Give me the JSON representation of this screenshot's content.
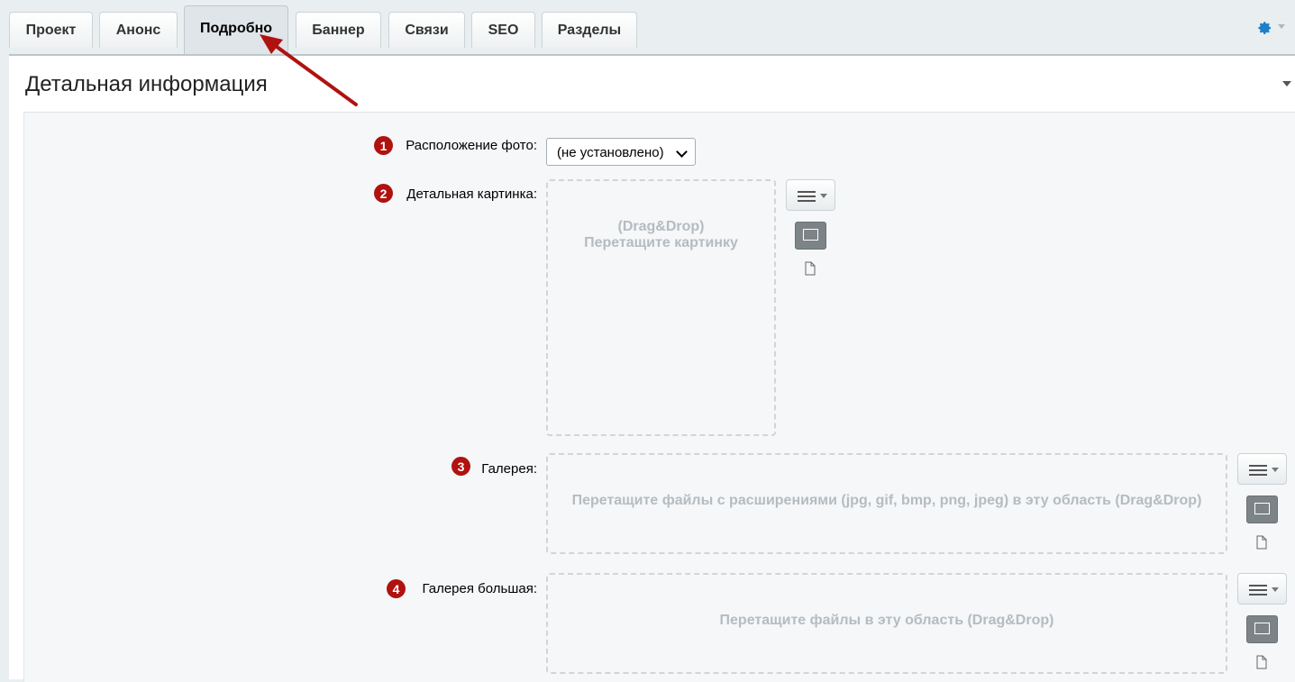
{
  "tabs": [
    {
      "label": "Проект"
    },
    {
      "label": "Анонс"
    },
    {
      "label": "Подробно",
      "active": true
    },
    {
      "label": "Баннер"
    },
    {
      "label": "Связи"
    },
    {
      "label": "SEO"
    },
    {
      "label": "Разделы"
    }
  ],
  "header": {
    "settings_icon": "gear-icon"
  },
  "section": {
    "title": "Детальная информация"
  },
  "fields": {
    "photo_position": {
      "num": "1",
      "label": "Расположение фото:",
      "value": "(не установлено)"
    },
    "detail_image": {
      "num": "2",
      "label": "Детальная картинка:",
      "drop_line1": "(Drag&Drop)",
      "drop_line2": "Перетащите картинку"
    },
    "gallery": {
      "num": "3",
      "label": "Галерея:",
      "drop_text": "Перетащите файлы с расширениями (jpg, gif, bmp, png, jpeg) в эту область (Drag&Drop)"
    },
    "gallery_big": {
      "num": "4",
      "label": "Галерея большая:",
      "drop_text": "Перетащите файлы в эту область (Drag&Drop)"
    }
  },
  "colors": {
    "accent": "#1e7fc8",
    "annotation": "#b0120f"
  }
}
